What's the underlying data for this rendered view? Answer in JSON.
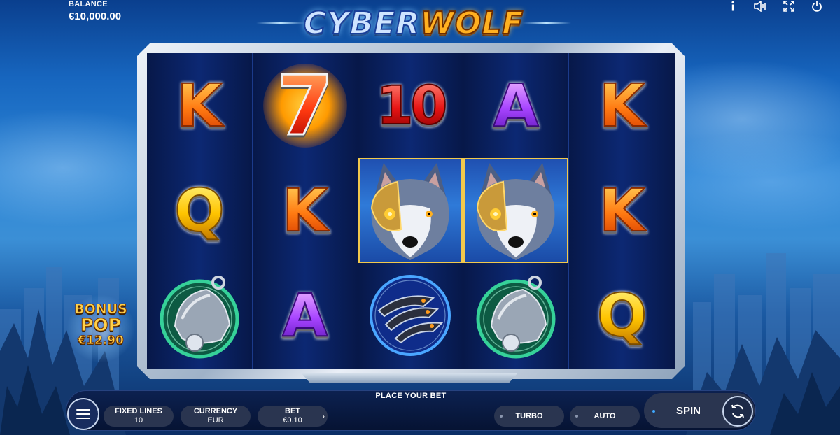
{
  "game": {
    "logo_part1": "CYBER",
    "logo_part2": "WOLF"
  },
  "header": {
    "balance_label": "BALANCE",
    "balance_value": "€10,000.00",
    "icons": [
      "info-icon",
      "sound-icon",
      "fullscreen-icon",
      "power-icon"
    ]
  },
  "reels": [
    [
      "K",
      "Q",
      "bell"
    ],
    [
      "7",
      "K",
      "A"
    ],
    [
      "10",
      "wolf",
      "claw"
    ],
    [
      "A",
      "wolf",
      "bell"
    ],
    [
      "K",
      "K",
      "Q"
    ]
  ],
  "bonus_pop": {
    "line1": "BONUS",
    "line2": "POP",
    "amount": "€12.90"
  },
  "controls": {
    "place_bet": "PLACE YOUR BET",
    "fixed_lines_label": "FIXED LINES",
    "fixed_lines_value": "10",
    "currency_label": "CURRENCY",
    "currency_value": "EUR",
    "bet_label": "BET",
    "bet_value": "€0.10",
    "turbo_label": "TURBO",
    "auto_label": "AUTO",
    "spin_label": "SPIN"
  },
  "colors": {
    "sky": "#1766bf",
    "reel_bg": "#0c2873",
    "panel": "#2a3550",
    "accent_gold": "#ffd24a"
  }
}
